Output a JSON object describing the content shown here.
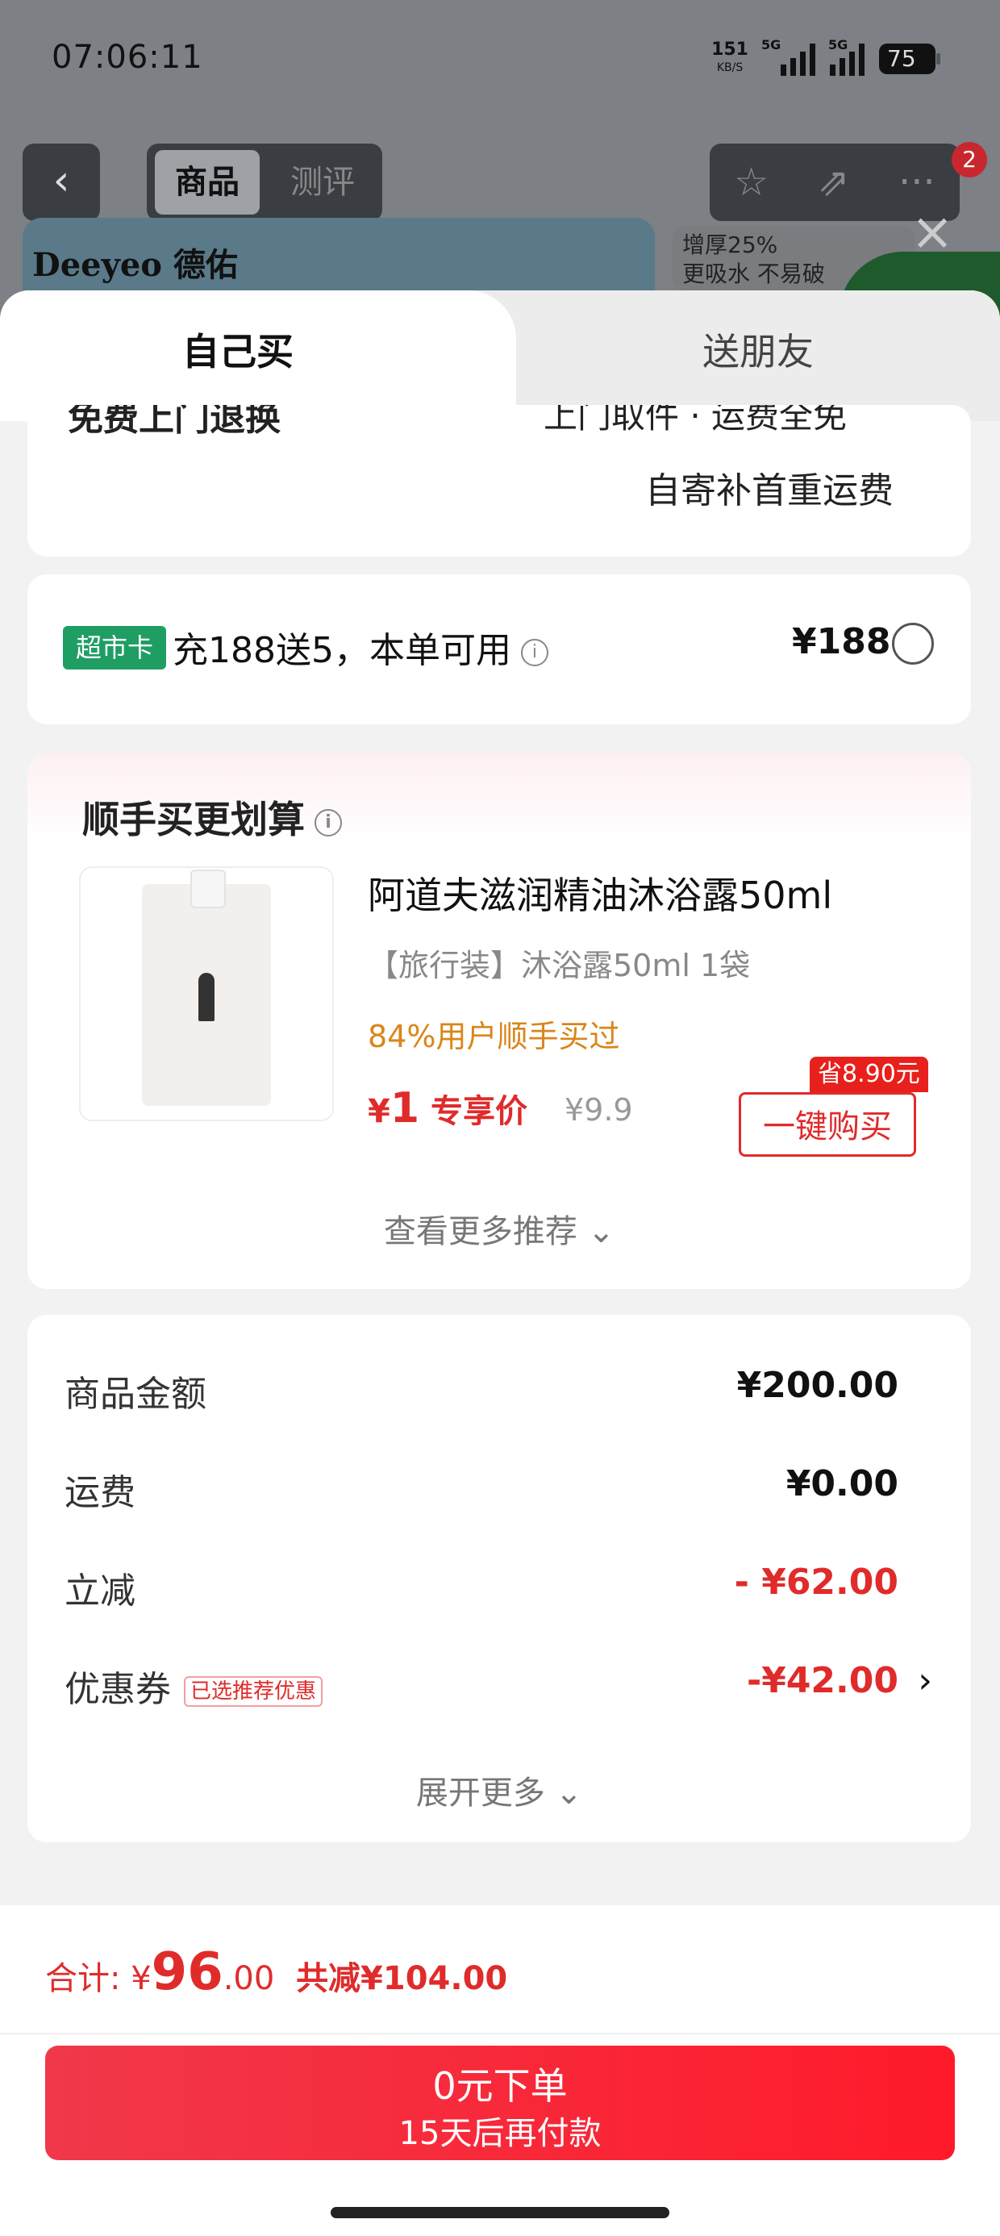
{
  "status": {
    "time": "07:06:11",
    "net_speed": "151",
    "net_unit": "KB/S",
    "sig1_label": "5G",
    "sig2_label": "5G",
    "battery": "75"
  },
  "nav": {
    "back_icon": "chevron-left-icon",
    "tab_product": "商品",
    "tab_review": "测评",
    "badge": "2"
  },
  "background": {
    "brand": "Deeyeo 德佑",
    "promo_line1": "增厚25%",
    "promo_line2": "更吸水 不易破"
  },
  "tabs": {
    "self": "自己买",
    "friend": "送朋友"
  },
  "shipping_card": {
    "cut_left": "免费上门退换",
    "cut_right": "上门取件 · 运费全免",
    "note": "自寄补首重运费"
  },
  "member_card": {
    "chip": "超市卡",
    "text": "充188送5，本单可用",
    "price": "¥188"
  },
  "addon": {
    "title": "顺手买更划算",
    "product_name": "阿道夫滋润精油沐浴露50ml",
    "spec": "【旅行装】沐浴露50ml 1袋",
    "buyers": "84%用户顺手买过",
    "currency": "¥",
    "price": "1",
    "price_label": "专享价",
    "orig_price": "¥9.9",
    "save_tag": "省8.90元",
    "buy_button": "一键购买",
    "more": "查看更多推荐 ⌄"
  },
  "summary": {
    "rows": [
      {
        "label": "商品金额",
        "value": "¥200.00"
      },
      {
        "label": "运费",
        "value": "¥0.00"
      },
      {
        "label": "立减",
        "value": "- ¥62.00"
      },
      {
        "label": "优惠券",
        "tag": "已选推荐优惠",
        "value": "-¥42.00"
      }
    ],
    "expand": "展开更多 ⌄"
  },
  "footer": {
    "total_label": "合计:",
    "currency": "¥",
    "total_int": "96",
    "total_dec": ".00",
    "reduce": "共减¥104.00",
    "order_main": "0元下单",
    "order_sub": "15天后再付款"
  },
  "colors": {
    "accent_red": "#e02b2b",
    "card_green": "#1f9e64",
    "buyers_orange": "#d9861a"
  }
}
